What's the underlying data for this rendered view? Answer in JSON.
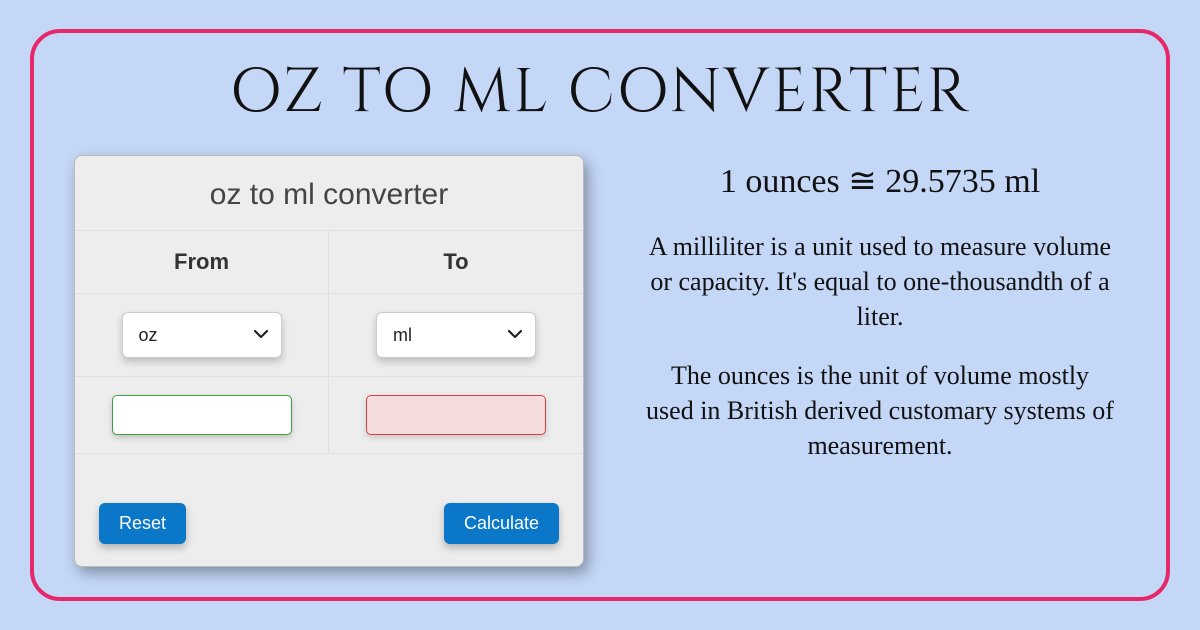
{
  "page_title": "OZ TO ML CONVERTER",
  "card": {
    "title": "oz to ml converter",
    "from_label": "From",
    "to_label": "To",
    "from_unit": "oz",
    "to_unit": "ml",
    "from_value": "",
    "to_value": "",
    "reset_label": "Reset",
    "calculate_label": "Calculate"
  },
  "info": {
    "equation": "1 ounces ≅ 29.5735 ml",
    "desc_ml": "A milliliter is a unit used to measure volume or capacity. It's equal to one-thousandth of a liter.",
    "desc_oz": "The ounces is the unit of volume mostly used in British derived customary systems of measurement."
  },
  "colors": {
    "frame_border": "#e6286a",
    "background": "#c4d7f7",
    "button": "#0a77c9"
  }
}
